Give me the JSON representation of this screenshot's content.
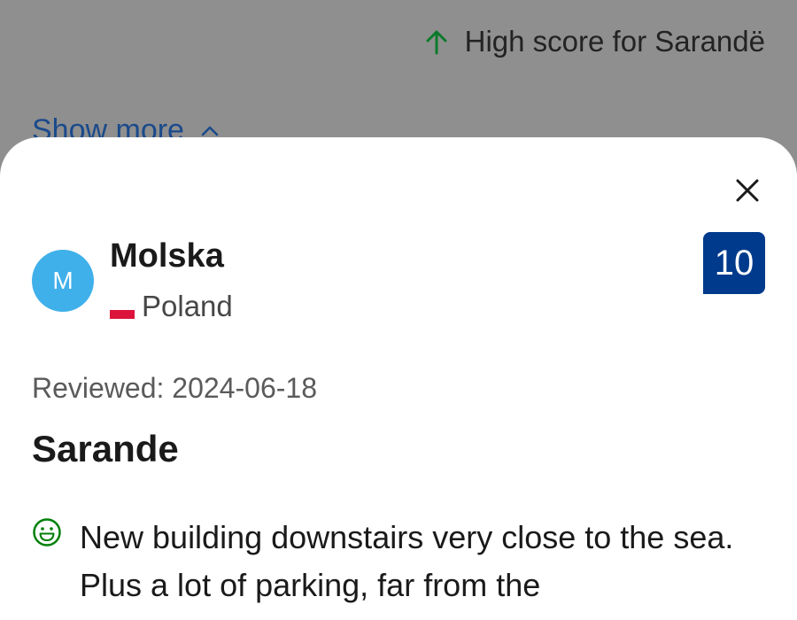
{
  "background": {
    "highlight_text": "High score for Sarandë",
    "highlight_icon": "arrow-up-icon",
    "show_more_label": "Show more",
    "show_more_icon": "chevron-up-icon"
  },
  "review": {
    "close_icon": "close-icon",
    "avatar_initial": "M",
    "reviewer_name": "Molska",
    "country": "Poland",
    "score": "10",
    "date": "Reviewed: 2024-06-18",
    "title": "Sarande",
    "positive_icon": "smile-icon",
    "positive_text": "New building downstairs very close to the sea. Plus a lot of parking, far from the"
  },
  "colors": {
    "backdrop": "#8f8f8f",
    "avatar": "#3fb0ea",
    "score_badge": "#003a8c",
    "positive_green": "#008009",
    "link_blue": "#1a4a8a"
  }
}
